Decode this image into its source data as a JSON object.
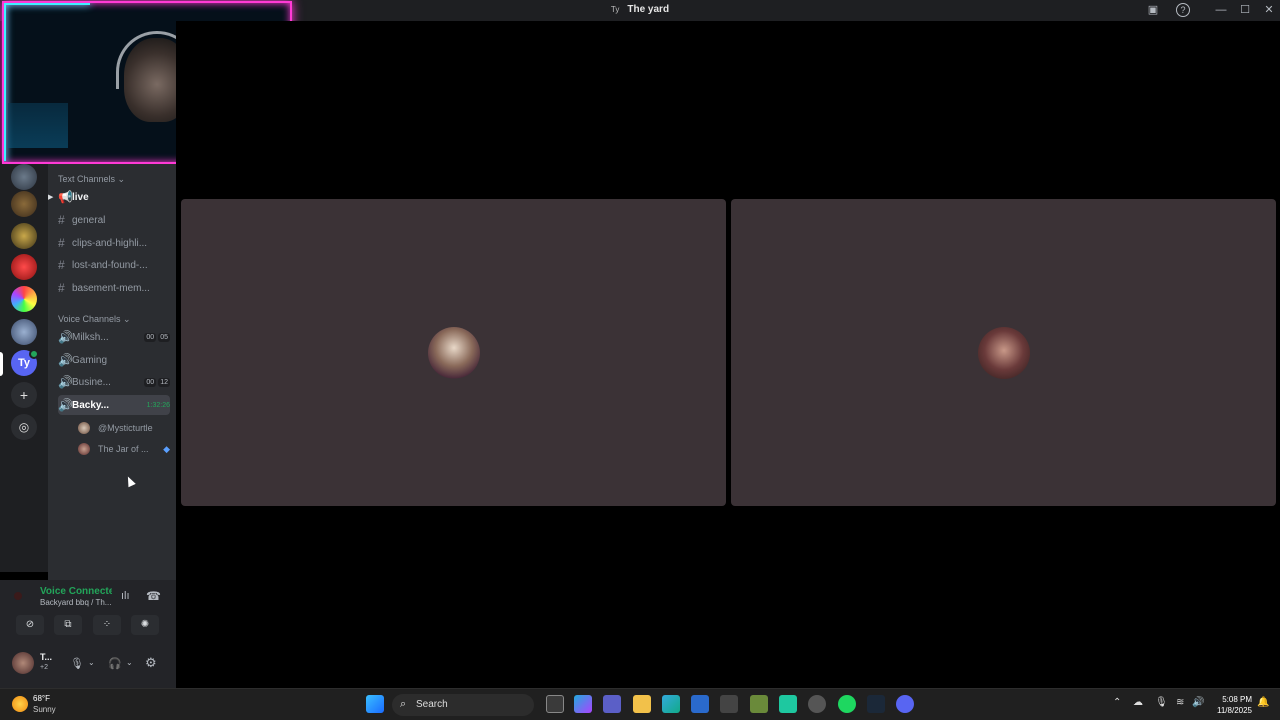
{
  "window": {
    "server_abbrev": "Ty",
    "title": "The yard"
  },
  "text_category": "Text Channels",
  "text_channels": [
    {
      "name": "live",
      "icon": "megaphone-icon"
    },
    {
      "name": "general",
      "icon": "hash-icon"
    },
    {
      "name": "clips-and-highli...",
      "icon": "hash-icon"
    },
    {
      "name": "lost-and-found-...",
      "icon": "hash-icon"
    },
    {
      "name": "basement-mem...",
      "icon": "hash-icon"
    }
  ],
  "voice_category": "Voice Channels",
  "voice_channels": [
    {
      "name": "Milksh...",
      "badge1": "00",
      "badge2": "05"
    },
    {
      "name": "Gaming"
    },
    {
      "name": "Busine...",
      "badge1": "00",
      "badge2": "12"
    },
    {
      "name": "Backy...",
      "timer": "1:32:26"
    }
  ],
  "voice_users": [
    "@Mysticturtle",
    "The Jar of ..."
  ],
  "server_badge": "Ty",
  "voice_panel": {
    "status": "Voice Connected",
    "location": "Backyard bbq / Th..."
  },
  "user": {
    "name": "T...",
    "status": "+2"
  },
  "taskbar": {
    "weather_temp": "68°F",
    "weather_desc": "Sunny",
    "search": "Search",
    "time": "5:08 PM",
    "date": "11/8/2025"
  },
  "colors": {
    "accent_green": "#23a55a",
    "tile_bg": "#3b3236",
    "webcam_glow": "#ff3ad6"
  }
}
